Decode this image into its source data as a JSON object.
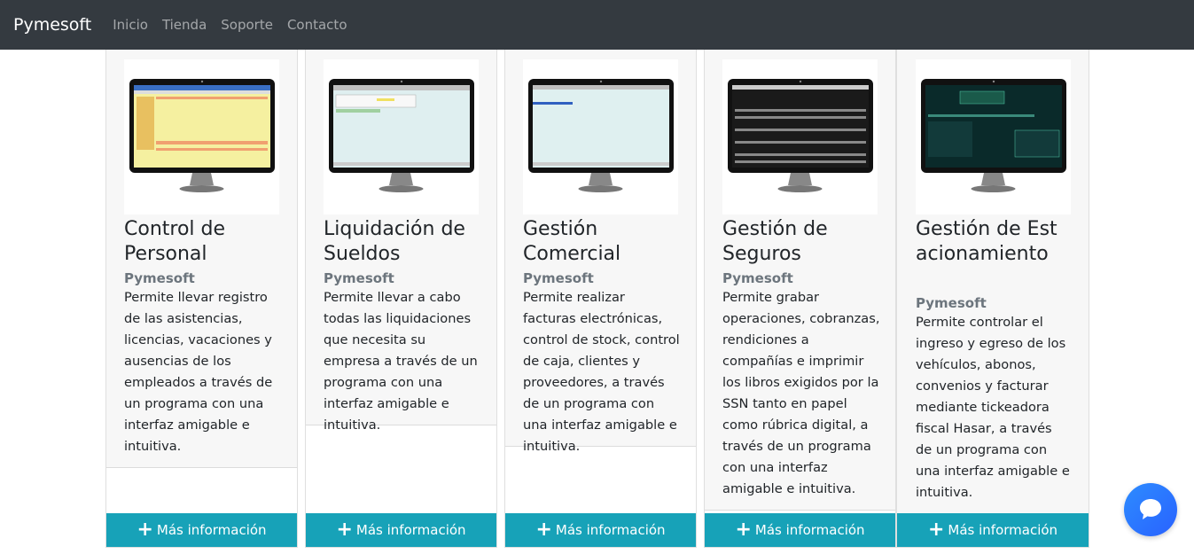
{
  "navbar": {
    "brand": "Pymesoft",
    "links": [
      "Inicio",
      "Tienda",
      "Soporte",
      "Contacto"
    ]
  },
  "cards": [
    {
      "title": "Control de Personal",
      "subtitle": "Pymesoft",
      "text": "Permite llevar registro de las asistencias, licencias, vacaciones y ausencias de los empleados a través de un programa con una interfaz amigable e intuitiva.",
      "button": "Más información",
      "screen_color": "#f5f0a0"
    },
    {
      "title": "Liquidación de Sueldos",
      "subtitle": "Pymesoft",
      "text": "Permite llevar a cabo todas las liquidaciones que necesita su empresa a través de un programa con una interfaz amigable e intuitiva.",
      "button": "Más información",
      "screen_color": "#dfeff0"
    },
    {
      "title": "Gestión Comercial",
      "subtitle": "Pymesoft",
      "text": "Permite realizar facturas electrónicas, control de stock, control de caja, clientes y proveedores, a través de un programa con una interfaz amigable e intuitiva.",
      "button": "Más información",
      "screen_color": "#dff0f0"
    },
    {
      "title": "Gestión de Seguros",
      "subtitle": "Pymesoft",
      "text": "Permite grabar operaciones, cobranzas, rendiciones a compañías e imprimir los libros exigidos por la SSN tanto en papel como rúbrica digital, a través de un programa con una interfaz amigable e intuitiva.",
      "button": "Más información",
      "screen_color": "#1a1a1a"
    },
    {
      "title": "Gestión de Estacionamiento",
      "subtitle": "Pymesoft",
      "text": "Permite controlar el ingreso y egreso de los vehículos, abonos, convenios y facturar mediante tickeadora fiscal Hasar, a través de un programa con una interfaz amigable e intuitiva.",
      "button": "Más información",
      "screen_color": "#0a2a2a"
    }
  ],
  "colors": {
    "navbar": "#343a40",
    "button": "#17a2b8",
    "chat": "#2962ff"
  }
}
